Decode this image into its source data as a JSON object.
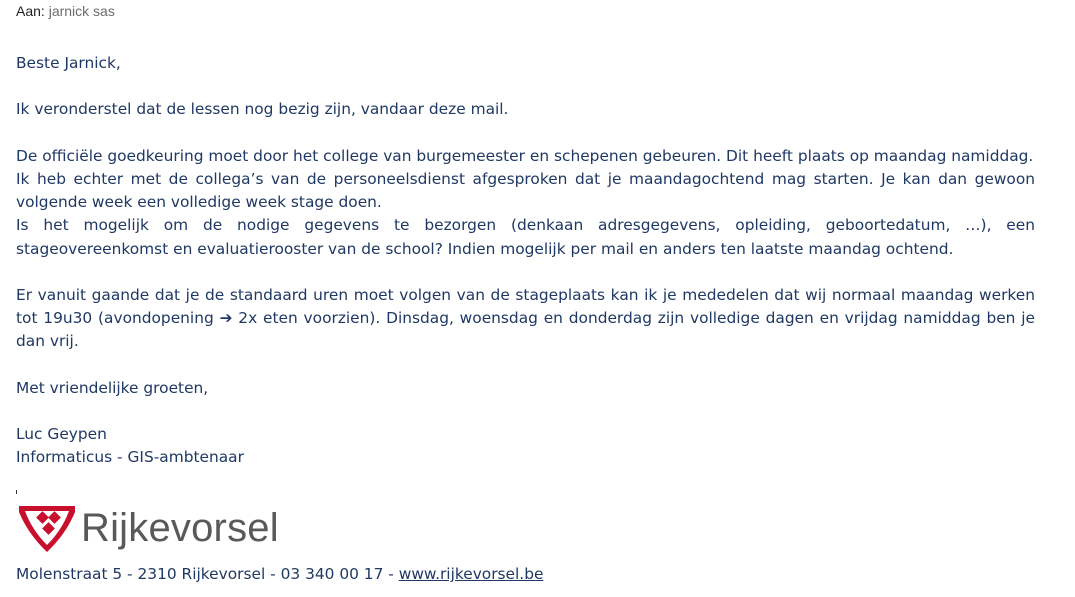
{
  "header": {
    "to_label": "Aan:",
    "to_name": "jarnick sas"
  },
  "body": {
    "greeting": "Beste Jarnick,",
    "p1": "Ik veronderstel dat de lessen nog bezig zijn, vandaar deze mail.",
    "p2_l1": "De officiële goedkeuring moet door het college van burgemeester en schepenen gebeuren. Dit heeft plaats op maandag namiddag.",
    "p2_l2": "Ik heb echter met de collega’s van de personeelsdienst afgesproken dat je maandagochtend mag starten. Je kan dan gewoon volgende week een volledige week stage doen.",
    "p2_l3": "Is het mogelijk om de nodige gegevens te bezorgen (denkaan adresgegevens, opleiding, geboortedatum, …), een stageovereenkomst en evaluatierooster van de school? Indien mogelijk per mail en anders ten laatste maandag ochtend.",
    "p3_a": "Er vanuit gaande dat je de standaard uren moet volgen van de stageplaats kan ik je mededelen dat wij normaal maandag werken tot 19u30 (avondopening",
    "p3_arrow": "➔",
    "p3_b": "2x eten voorzien). Dinsdag, woensdag en donderdag zijn volledige dagen en vrijdag namiddag ben je dan vrij.",
    "closing": "Met vriendelijke groeten,"
  },
  "signature": {
    "name": "Luc Geypen",
    "role": "Informaticus - GIS-ambtenaar",
    "logo_text": "Rijkevorsel",
    "address": "Molenstraat 5 - 2310 Rijkevorsel - 03 340 00 17 - ",
    "website": "www.rijkevorsel.be"
  },
  "colors": {
    "text": "#1f3864",
    "logo_red": "#c8102e",
    "logo_gray": "#58595b"
  }
}
